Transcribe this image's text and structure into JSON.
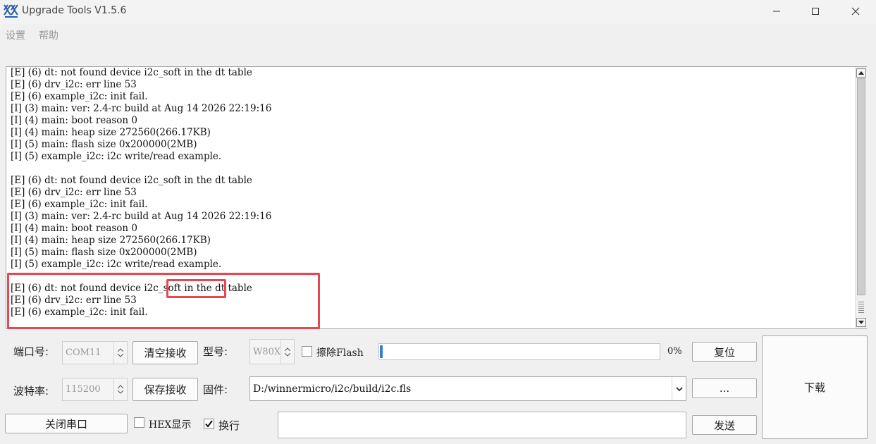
{
  "window": {
    "title": "Upgrade Tools V1.5.6"
  },
  "menu": [
    {
      "label": "设置"
    },
    {
      "label": "帮助"
    }
  ],
  "log": {
    "lines": [
      "[E] (6) dt: not found device i2c_soft in the dt table",
      "[E] (6) drv_i2c: err line 53",
      "[E] (6) example_i2c: init fail.",
      "[I] (3) main: ver: 2.4-rc build at Aug 14 2026 22:19:16",
      "[I] (4) main: boot reason 0",
      "[I] (4) main: heap size 272560(266.17KB)",
      "[I] (5) main: flash size 0x200000(2MB)",
      "[I] (5) example_i2c: i2c write/read example.",
      "",
      "[E] (6) dt: not found device i2c_soft in the dt table",
      "[E] (6) drv_i2c: err line 53",
      "[E] (6) example_i2c: init fail.",
      "[I] (3) main: ver: 2.4-rc build at Aug 14 2026 22:19:16",
      "[I] (4) main: boot reason 0",
      "[I] (4) main: heap size 272560(266.17KB)",
      "[I] (5) main: flash size 0x200000(2MB)",
      "[I] (5) example_i2c: i2c write/read example.",
      "",
      "[E] (6) dt: not found device i2c_soft in the dt table",
      "[E] (6) drv_i2c: err line 53",
      "[E] (6) example_i2c: init fail."
    ]
  },
  "controls": {
    "port_label": "端口号:",
    "port_value": "COM11",
    "baud_label": "波特率:",
    "baud_value": "115200",
    "clear_receive": "清空接收",
    "save_receive": "保存接收",
    "model_label": "型号:",
    "model_value": "W80X",
    "erase_flash": "擦除Flash",
    "erase_checked": false,
    "progress_percent": 1,
    "progress_text": "0%",
    "reset": "复位",
    "firmware_label": "固件:",
    "firmware_path": "D:/winnermicro/i2c/build/i2c.fls",
    "browse": "...",
    "download": "下载",
    "close_port": "关闭串口",
    "hex_display": "HEX显示",
    "hex_checked": false,
    "newline": "换行",
    "newline_checked": true,
    "send_text": "",
    "send": "发送"
  },
  "colors": {
    "highlight": "#e8474f",
    "progress": "#2f7fd8"
  },
  "icons": [
    "app-logo-icon",
    "minimize-icon",
    "maximize-icon",
    "close-icon",
    "scroll-up-icon",
    "scroll-down-icon",
    "chevron-down-icon",
    "checkmark-icon"
  ]
}
